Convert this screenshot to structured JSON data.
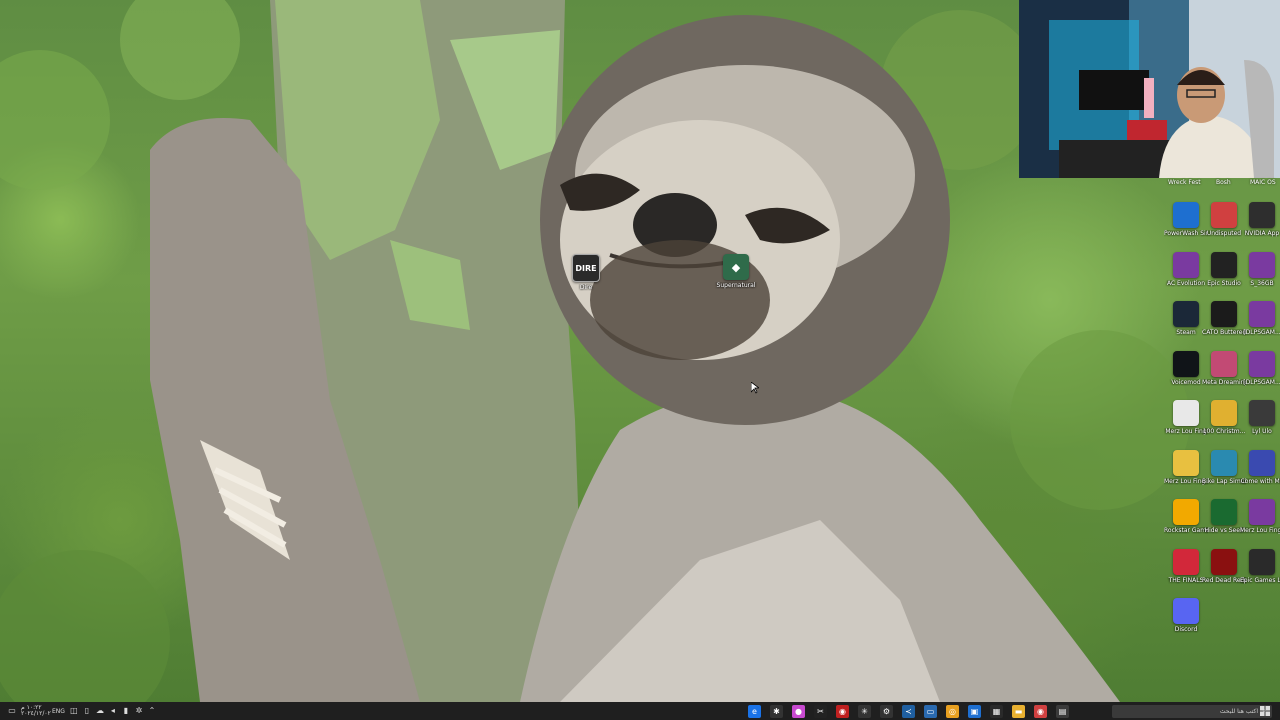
{
  "desktop": {
    "wallpaper": "sloth-hugging-tree",
    "top_partial_labels": [
      {
        "text": "Wreck Fest"
      },
      {
        "text": "Bosh"
      },
      {
        "text": "MAIC OS"
      }
    ],
    "center_icons": [
      {
        "label": "Dire",
        "icon": "dire-icon",
        "color": "#2a2a2a"
      },
      {
        "label": "Supernatural",
        "icon": "supernatural-icon",
        "color": "#2f6b4a"
      }
    ],
    "right_icons": [
      {
        "label": "PowerWash Simulator",
        "icon": "powerwash-icon",
        "color": "#1e6fd0"
      },
      {
        "label": "Undisputed",
        "icon": "undisputed-icon",
        "color": "#d04040"
      },
      {
        "label": "NVIDIA App",
        "icon": "nvidia-icon",
        "color": "#2e2e2e"
      },
      {
        "label": "AC Evolution",
        "icon": "archive-icon",
        "color": "#7a3aa0"
      },
      {
        "label": "Epic Studio",
        "icon": "studio-icon",
        "color": "#222222"
      },
      {
        "label": "S_36GB",
        "icon": "archive-icon",
        "color": "#7a3aa0"
      },
      {
        "label": "Steam",
        "icon": "steam-icon",
        "color": "#1b2838"
      },
      {
        "label": "CATO Buttered",
        "icon": "cato-icon",
        "color": "#1b1b1b"
      },
      {
        "label": "[DLPSGAM...",
        "icon": "archive-icon",
        "color": "#7a3aa0"
      },
      {
        "label": "Voicemod",
        "icon": "voicemod-icon",
        "color": "#101418"
      },
      {
        "label": "Meta Dreaming",
        "icon": "anime-icon",
        "color": "#c24a74"
      },
      {
        "label": "[DLPSGAM...",
        "icon": "archive-icon",
        "color": "#7a3aa0"
      },
      {
        "label": "Merz Lou Fing",
        "icon": "file-icon",
        "color": "#e8e8e8"
      },
      {
        "label": "100 Christm...",
        "icon": "homer-icon",
        "color": "#e0b030"
      },
      {
        "label": "Lyl Ulo",
        "icon": "chrome-app-icon",
        "color": "#3a3a3a"
      },
      {
        "label": "Merz Lou Fing 2023",
        "icon": "folder-icon",
        "color": "#e8c040"
      },
      {
        "label": "Bike Lap Simulator",
        "icon": "bike-icon",
        "color": "#2a8ab0"
      },
      {
        "label": "Come with Me",
        "icon": "game-icon",
        "color": "#3a4ab0"
      },
      {
        "label": "Rockstar Games",
        "icon": "rockstar-icon",
        "color": "#f2a900"
      },
      {
        "label": "Hide vs Seek",
        "icon": "hide-seek-icon",
        "color": "#1a6a30"
      },
      {
        "label": "Merz Lou Fing 2024",
        "icon": "archive-icon",
        "color": "#7a3aa0"
      },
      {
        "label": "THE FINALS",
        "icon": "finals-icon",
        "color": "#d2283a"
      },
      {
        "label": "Red Dead Redempti...",
        "icon": "rdr-icon",
        "color": "#8a1010"
      },
      {
        "label": "Epic Games Launcher",
        "icon": "epic-icon",
        "color": "#2a2a2a"
      },
      {
        "label": "Discord",
        "icon": "discord-icon",
        "color": "#5865f2"
      }
    ]
  },
  "taskbar": {
    "clock_time": "١٠:٢٢ م",
    "clock_date": "٢٠٢٤/١٢/٠٢",
    "language": "ENG",
    "search_placeholder": "اكتب هنا للبحث",
    "pinned": [
      {
        "icon": "edge-icon",
        "color": "#1a73e8",
        "glyph": "e"
      },
      {
        "icon": "settings-gear-icon",
        "color": "#333333",
        "glyph": "✱"
      },
      {
        "icon": "chrome-icon",
        "color": "#c84ad0",
        "glyph": "●"
      },
      {
        "icon": "capcut-icon",
        "color": "#222222",
        "glyph": "✂"
      },
      {
        "icon": "record-icon",
        "color": "#c02020",
        "glyph": "◉"
      },
      {
        "icon": "sparkle-icon",
        "color": "#333333",
        "glyph": "✳"
      },
      {
        "icon": "gear-icon",
        "color": "#333333",
        "glyph": "⚙"
      },
      {
        "icon": "vscode-icon",
        "color": "#1f5fa0",
        "glyph": "≺"
      },
      {
        "icon": "screen-icon",
        "color": "#2a6ab0",
        "glyph": "▭"
      },
      {
        "icon": "google-chrome-icon",
        "color": "#e8a020",
        "glyph": "◎"
      },
      {
        "icon": "window-icon",
        "color": "#1e6fd0",
        "glyph": "▣"
      },
      {
        "icon": "calendar-icon",
        "color": "#2a2a2a",
        "glyph": "▦"
      },
      {
        "icon": "folder-icon",
        "color": "#e8b030",
        "glyph": "▬"
      },
      {
        "icon": "chrome-alt-icon",
        "color": "#d04040",
        "glyph": "◉"
      },
      {
        "icon": "store-icon",
        "color": "#3a3a3a",
        "glyph": "▤"
      }
    ]
  }
}
